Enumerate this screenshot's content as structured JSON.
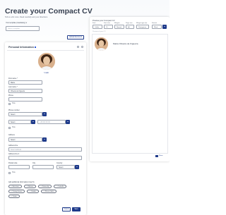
{
  "header": {
    "title": "Create your Compact CV",
    "subtitle": "Tell us a bit more. Read carefully and your directions",
    "template_label": "Your template (mandatory) ▾",
    "template_placeholder": "Select a template",
    "upload_label": "Upload document"
  },
  "form": {
    "section_title": "Personal Information",
    "edit_label": "✎ Edit",
    "fields": [
      {
        "label": "First name *",
        "value": "Maria"
      },
      {
        "label": "Last name *",
        "value": "Oliveira de Figueira"
      },
      {
        "label": "Phone",
        "value": ""
      },
      {
        "label": "Phone number",
        "value": "Select"
      },
      {
        "label": "",
        "value": "Select",
        "extra": "+45 000 00 00"
      },
      {
        "label": "Address",
        "value": "Select"
      },
      {
        "label": "Address line",
        "value": "Select address"
      },
      {
        "label": "Address line 2",
        "value": ""
      },
      {
        "label": "Postal code",
        "value": ""
      },
      {
        "label": "City",
        "value": ""
      },
      {
        "label": "Country",
        "value": "Select"
      }
    ],
    "checks": [
      "Hide",
      "Hide",
      "Hide"
    ],
    "links_label": "Add additional information (max 5)",
    "chips": [
      "+ Birth date",
      "+ Website",
      "+ Nationality",
      "+ LinkedIn",
      "+ Driving license",
      "+ Gender",
      "+ Place of birth",
      "+ Twitter"
    ],
    "cancel_label": "Cancel",
    "save_label": "Save"
  },
  "preview": {
    "title": "Preview your Compact CV",
    "controls": [
      {
        "label": "Font",
        "value": "Calibri"
      },
      {
        "label": "Font size",
        "value": "10"
      },
      {
        "label": "Margins",
        "value": "Normal"
      },
      {
        "label": "Page size",
        "value": "A4"
      },
      {
        "label": "Margin type (in)",
        "value": "Portuguese"
      },
      {
        "label": "Format",
        "value": "Word"
      }
    ],
    "hint": "Preview of your CV",
    "name": "Maria Oliveira de Figueira",
    "footer": "Share"
  },
  "colors": {
    "accent": "#1e3a8a",
    "skin": "#e7c6a4",
    "hair": "#3b2314"
  }
}
